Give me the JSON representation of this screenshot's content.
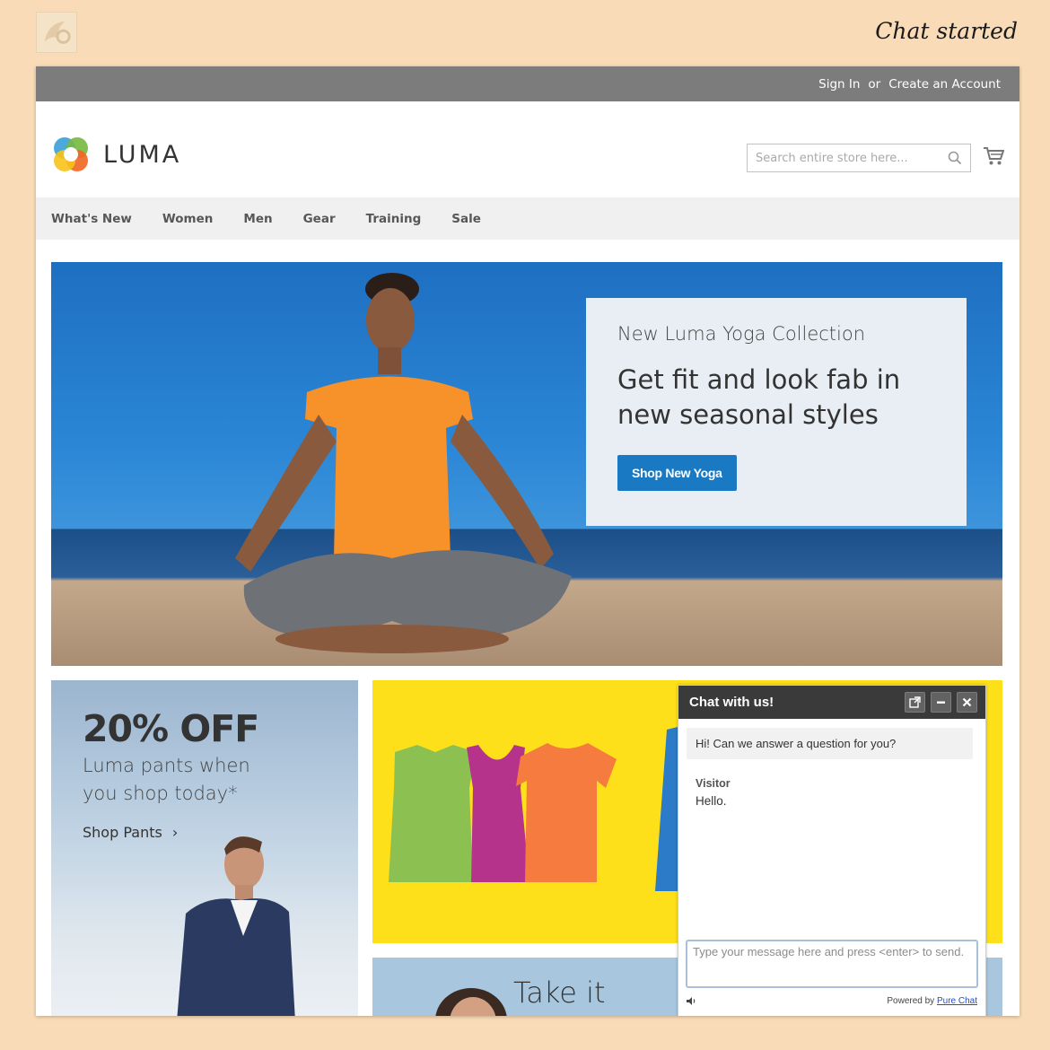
{
  "caption": "Chat started",
  "topbar": {
    "sign_in": "Sign In",
    "or": "or",
    "create_account": "Create an Account"
  },
  "header": {
    "logo_text": "LUMA",
    "search_placeholder": "Search entire store here..."
  },
  "nav": {
    "items": [
      "What's New",
      "Women",
      "Men",
      "Gear",
      "Training",
      "Sale"
    ]
  },
  "hero": {
    "subtitle": "New Luma Yoga Collection",
    "title_line1": "Get fit and look fab in",
    "title_line2": "new seasonal styles",
    "button": "Shop New Yoga"
  },
  "promo_left": {
    "title": "20% OFF",
    "subtitle": "Luma pants when you shop today*",
    "link": "Shop Pants"
  },
  "promo_blue": {
    "title": "Take it"
  },
  "chat": {
    "title": "Chat with us!",
    "greeting": "Hi! Can we answer a question for you?",
    "sender": "Visitor",
    "message": "Hello.",
    "input_placeholder": "Type your message here and press <enter> to send.",
    "powered_by": "Powered by",
    "provider": "Pure Chat"
  },
  "colors": {
    "accent_blue": "#1979c3",
    "chat_header": "#3a3a3a",
    "topbar": "#7b7c7b",
    "promo_yellow": "#fde019"
  }
}
